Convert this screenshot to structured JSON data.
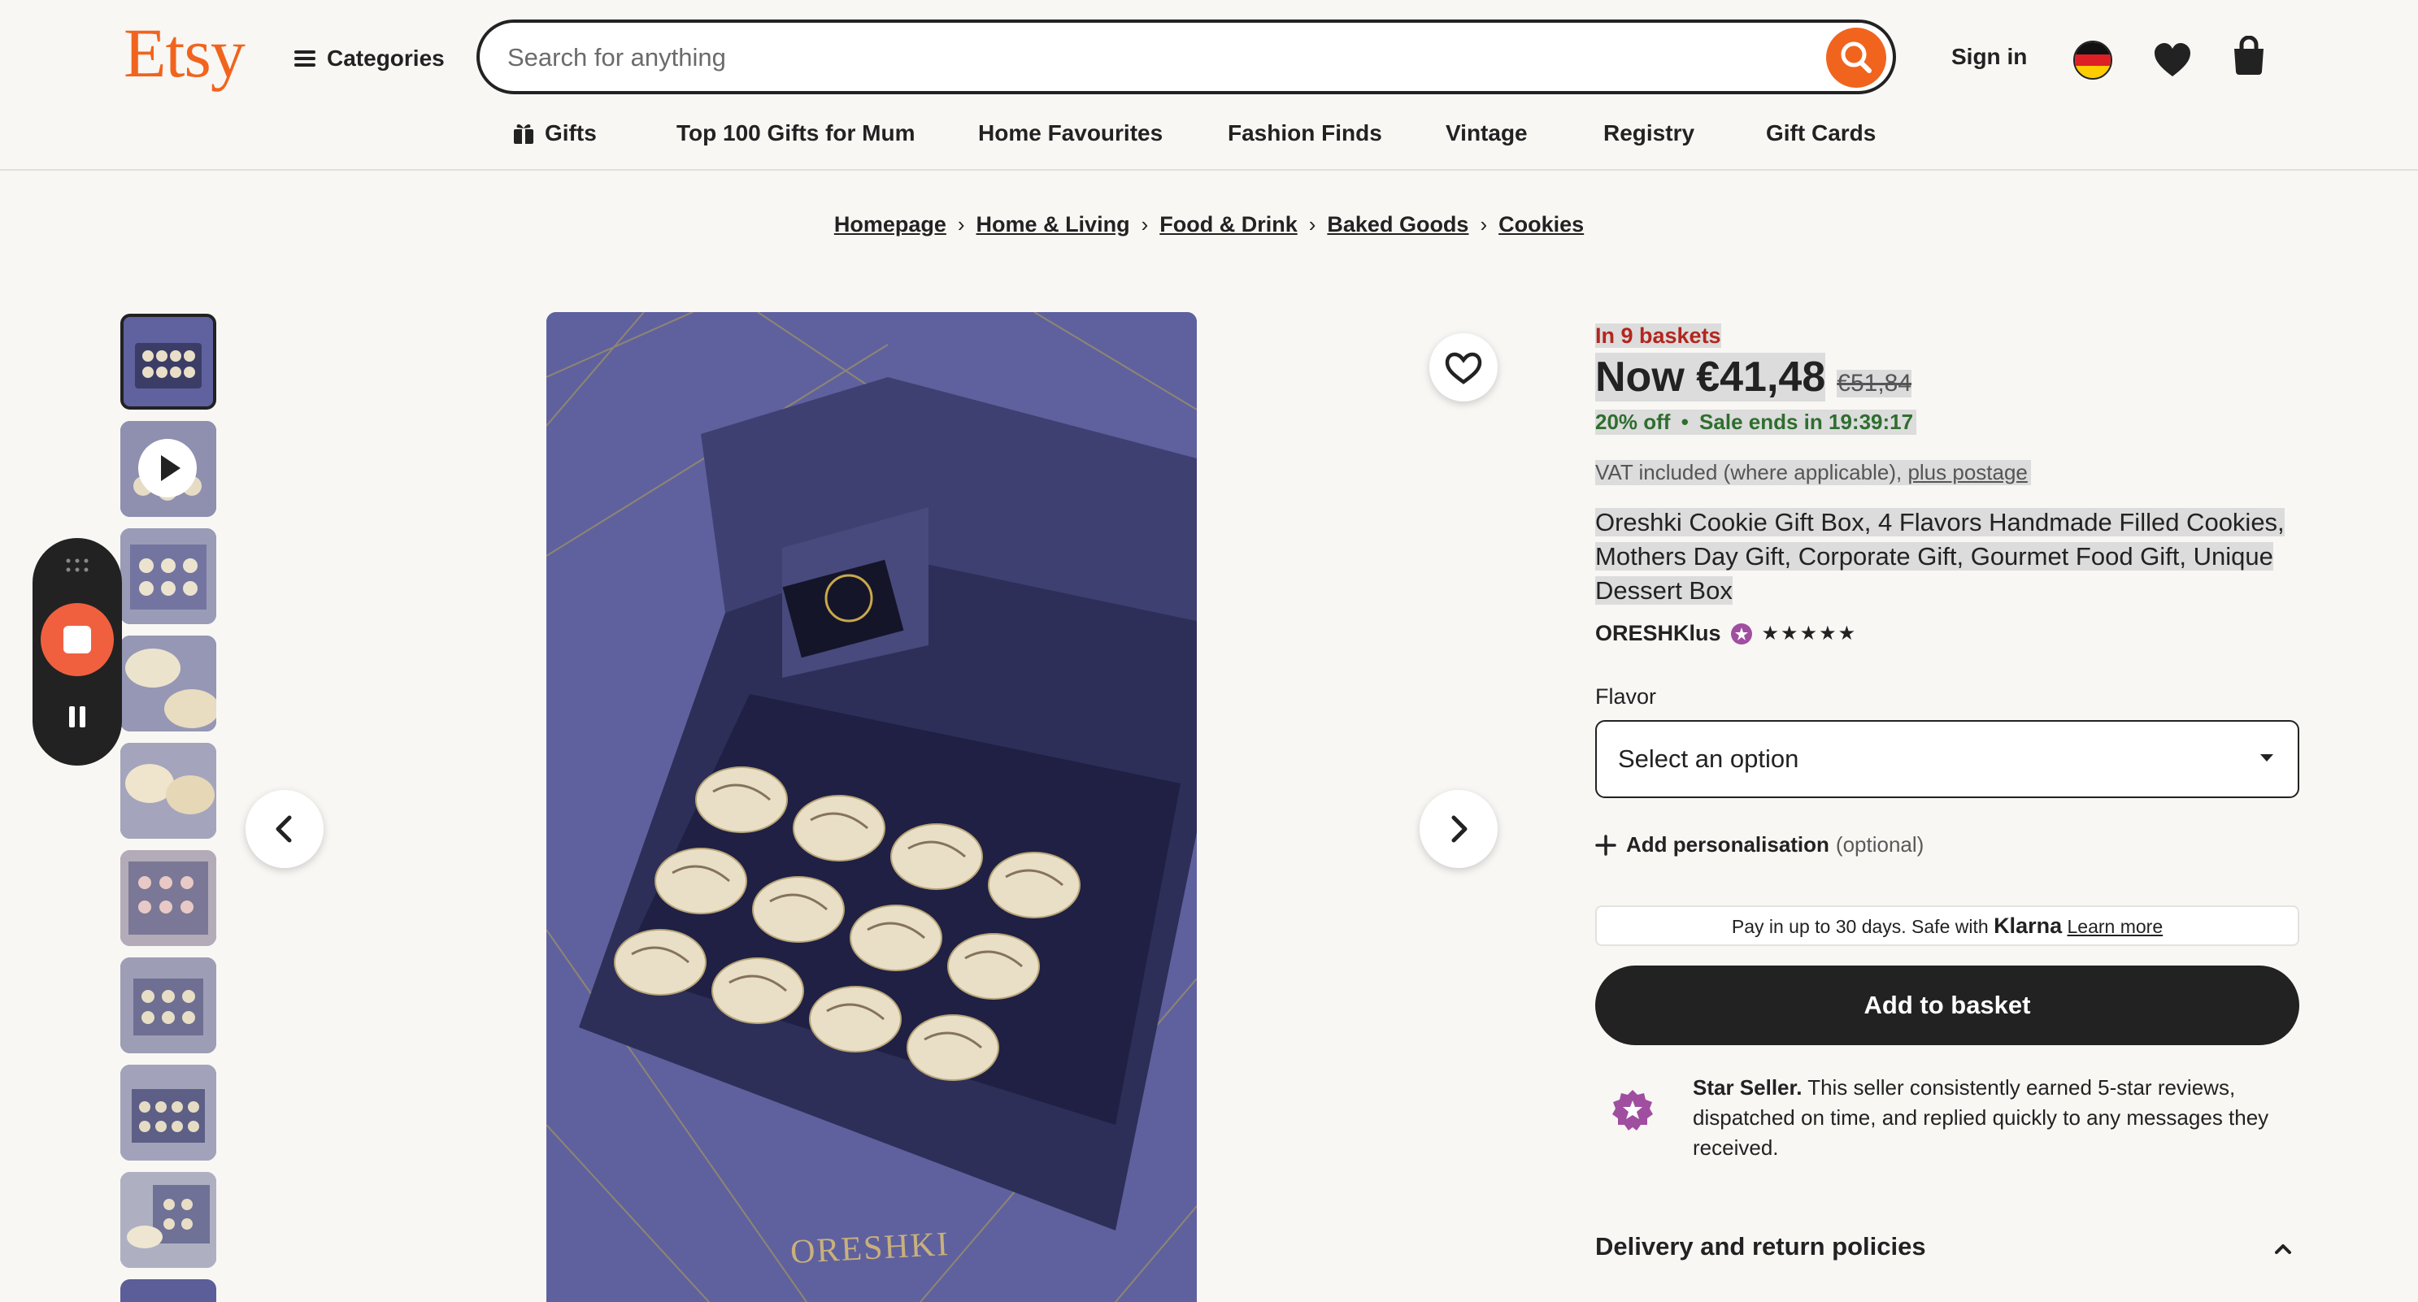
{
  "header": {
    "logo": "Etsy",
    "categories_label": "Categories",
    "search_placeholder": "Search for anything",
    "sign_in": "Sign in"
  },
  "nav": {
    "items": [
      "Gifts",
      "Top 100 Gifts for Mum",
      "Home Favourites",
      "Fashion Finds",
      "Vintage",
      "Registry",
      "Gift Cards"
    ]
  },
  "breadcrumb": [
    "Homepage",
    "Home & Living",
    "Food & Drink",
    "Baked Goods",
    "Cookies"
  ],
  "product": {
    "baskets": "In 9 baskets",
    "price": "Now €41,48",
    "old_price": "€51,84",
    "discount": "20% off",
    "sale": "Sale ends in 19:39:17",
    "vat": "VAT included (where applicable),",
    "postage_link": "plus postage",
    "title": "Oreshki Cookie Gift Box, 4 Flavors Handmade Filled Cookies, Mothers Day Gift, Corporate Gift, Gourmet Food Gift, Unique Dessert Box",
    "shop": "ORESHKlus",
    "stars": "★★★★★",
    "flavor_label": "Flavor",
    "flavor_select": "Select an option",
    "personalise_label": "Add personalisation",
    "personalise_optional": "(optional)",
    "klarna_text": "Pay in up to 30 days. Safe with",
    "klarna_brand": "Klarna",
    "klarna_link": "Learn more",
    "add_to_basket": "Add to basket",
    "star_seller_title": "Star Seller.",
    "star_seller_text": "This seller consistently earned 5-star reviews, dispatched on time, and replied quickly to any messages they received.",
    "delivery": "Delivery and return policies",
    "image_brand": "ORESHKI"
  },
  "colors": {
    "brand": "#f1641e",
    "price_red": "#b3261e",
    "sale_green": "#2f6e2f",
    "star_purple": "#a04ea0"
  }
}
